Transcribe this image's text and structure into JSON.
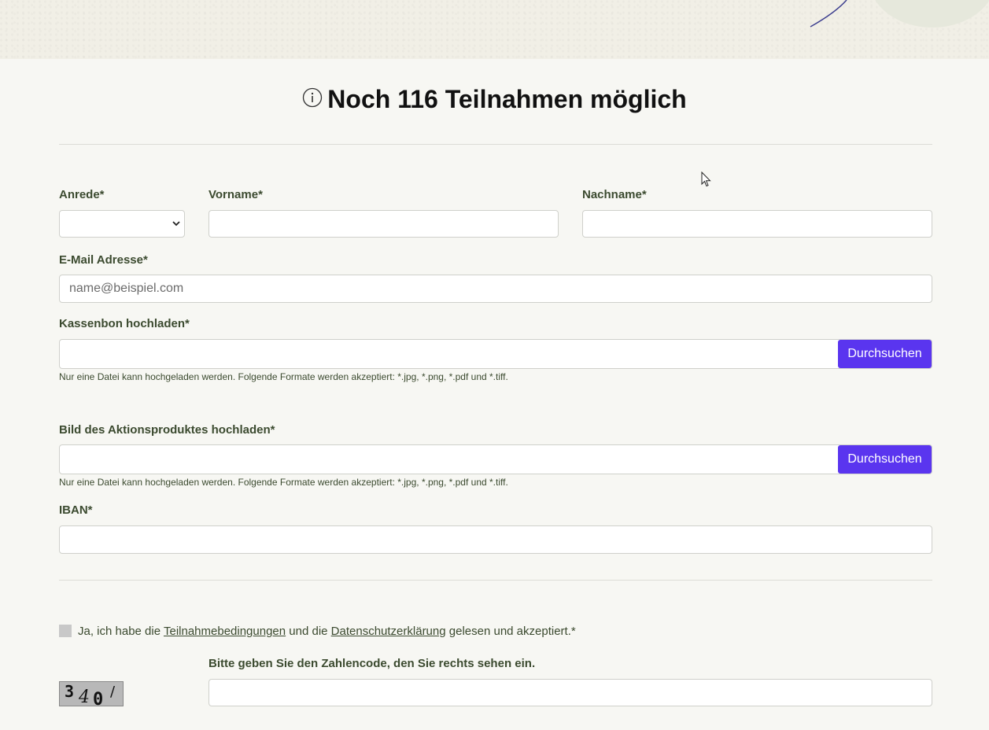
{
  "heading": {
    "icon": "info-icon",
    "text": "Noch 116 Teilnahmen möglich"
  },
  "form": {
    "salutation": {
      "label": "Anrede*",
      "value": ""
    },
    "first_name": {
      "label": "Vorname*",
      "value": ""
    },
    "last_name": {
      "label": "Nachname*",
      "value": ""
    },
    "email": {
      "label": "E-Mail Adresse*",
      "placeholder": "name@beispiel.com",
      "value": ""
    },
    "receipt_upload": {
      "label": "Kassenbon hochladen*",
      "button": "Durchsuchen",
      "hint": "Nur eine Datei kann hochgeladen werden. Folgende Formate werden akzeptiert: *.jpg, *.png, *.pdf und *.tiff."
    },
    "product_upload": {
      "label": "Bild des Aktionsproduktes hochladen*",
      "button": "Durchsuchen",
      "hint": "Nur eine Datei kann hochgeladen werden. Folgende Formate werden akzeptiert: *.jpg, *.png, *.pdf und *.tiff."
    },
    "iban": {
      "label": "IBAN*",
      "value": ""
    },
    "consent": {
      "prefix": "Ja, ich habe die ",
      "link_terms": "Teilnahmebedingungen",
      "middle": " und die ",
      "link_privacy": "Datenschutzerklärung",
      "suffix": " gelesen und akzeptiert.*",
      "checked": false
    },
    "captcha": {
      "label": "Bitte geben Sie den Zahlencode, den Sie rechts sehen ein.",
      "digits": [
        "3",
        "4",
        "0",
        "/"
      ],
      "value": ""
    }
  },
  "colors": {
    "page_bg": "#f7f7f3",
    "text": "#3b4a2f",
    "accent_button": "#5a35ef",
    "banner_stroke": "#3d3f8f"
  }
}
